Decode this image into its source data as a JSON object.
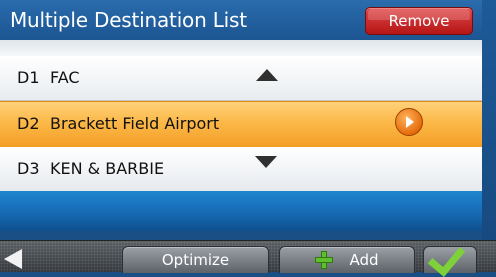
{
  "header": {
    "title": "Multiple Destination List",
    "remove_label": "Remove"
  },
  "destinations": [
    {
      "code": "D1",
      "name": "FAC"
    },
    {
      "code": "D2",
      "name": "Brackett Field Airport",
      "selected": true
    },
    {
      "code": "D3",
      "name": "KEN & BARBIE"
    }
  ],
  "toolbar": {
    "optimize_label": "Optimize",
    "add_label": "Add"
  },
  "icons": {
    "back": "back-arrow-icon",
    "scroll_up": "scroll-up-icon",
    "scroll_down": "scroll-down-icon",
    "detail": "detail-arrow-icon",
    "add": "plus-icon",
    "confirm": "checkmark-icon"
  },
  "colors": {
    "header": "#1f5a98",
    "selected_row": "#f7ac36",
    "remove_button": "#c42020"
  }
}
